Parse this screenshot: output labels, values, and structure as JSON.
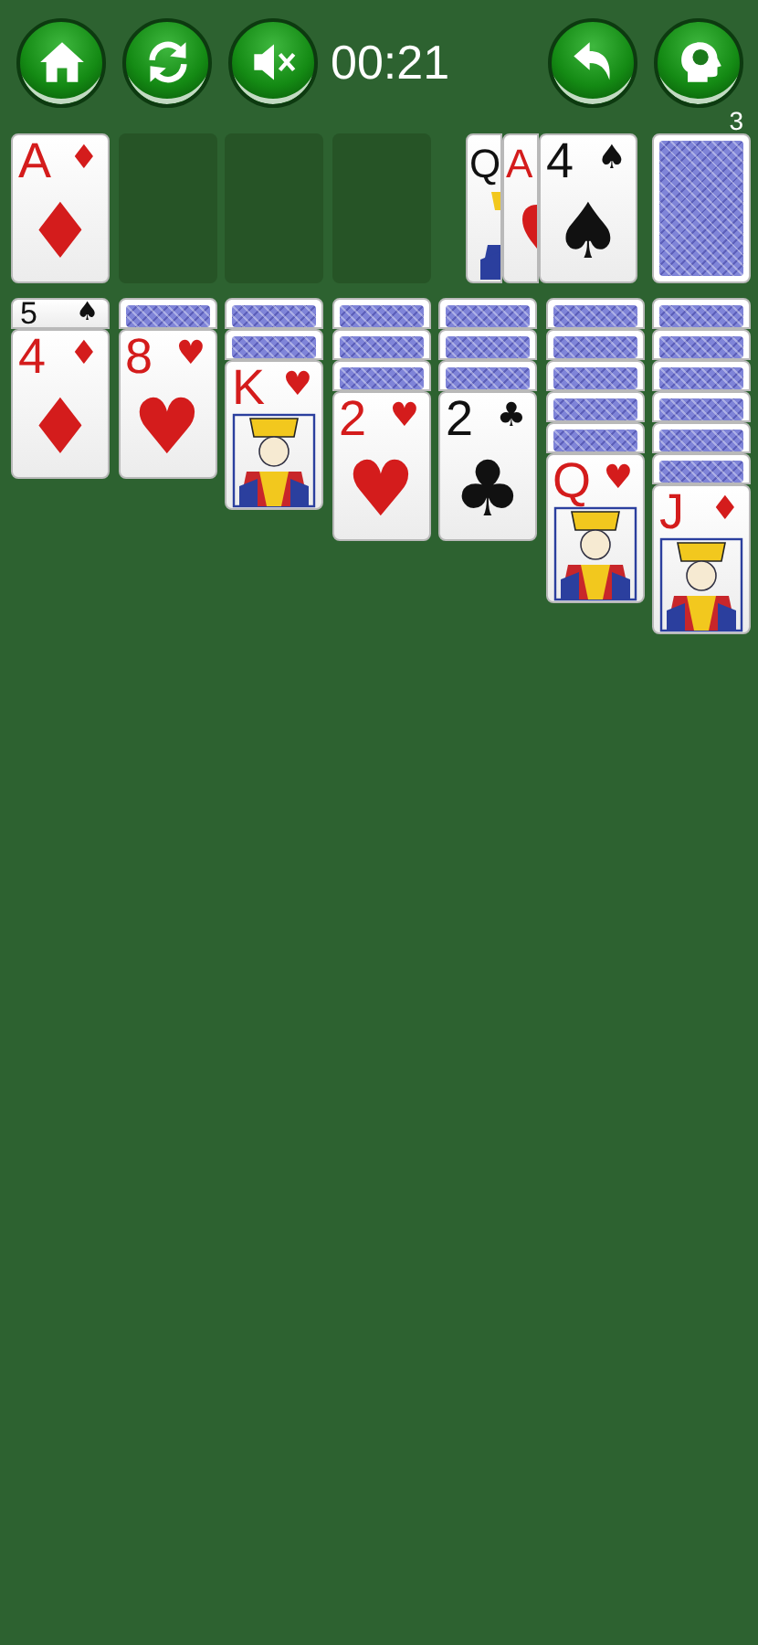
{
  "toolbar": {
    "left_buttons": [
      {
        "kind": "home"
      },
      {
        "kind": "restart"
      },
      {
        "kind": "sound",
        "muted": true
      }
    ],
    "timer": "00:21",
    "right_buttons": [
      {
        "kind": "undo"
      },
      {
        "kind": "hint",
        "badge": "3"
      }
    ]
  },
  "foundations": [
    {
      "kind": "pip",
      "rank": "A",
      "red": true,
      "corner_suit": "♦",
      "center_suit": "♦"
    },
    {
      "kind": "empty"
    },
    {
      "kind": "empty"
    },
    {
      "kind": "empty"
    }
  ],
  "waste": [
    {
      "kind": "court",
      "rank": "Q",
      "red": false
    },
    {
      "kind": "pip",
      "rank": "A",
      "red": true
    },
    {
      "kind": "pip",
      "rank": "4",
      "red": false,
      "corner_suit": "♠",
      "center_suit": "♠"
    }
  ],
  "stock": {
    "kind": "back"
  },
  "tableau": [
    {
      "cards": [
        {
          "kind": "pip",
          "rank": "5",
          "red": false,
          "corner_suit": "♠"
        },
        {
          "kind": "pip",
          "rank": "4",
          "red": true,
          "corner_suit": "♦",
          "center_suit": "♦"
        }
      ]
    },
    {
      "cards": [
        {
          "kind": "back"
        },
        {
          "kind": "pip",
          "rank": "8",
          "red": true,
          "corner_suit": "♥",
          "center_suit": "♥"
        }
      ]
    },
    {
      "cards": [
        {
          "kind": "back"
        },
        {
          "kind": "back"
        },
        {
          "kind": "court",
          "rank": "K",
          "red": true,
          "corner_suit": "♥"
        }
      ]
    },
    {
      "cards": [
        {
          "kind": "back"
        },
        {
          "kind": "back"
        },
        {
          "kind": "back"
        },
        {
          "kind": "pip",
          "rank": "2",
          "red": true,
          "corner_suit": "♥",
          "center_suit": "♥"
        }
      ]
    },
    {
      "cards": [
        {
          "kind": "back"
        },
        {
          "kind": "back"
        },
        {
          "kind": "back"
        },
        {
          "kind": "pip",
          "rank": "2",
          "red": false,
          "corner_suit": "♣",
          "center_suit": "♣"
        }
      ]
    },
    {
      "cards": [
        {
          "kind": "back"
        },
        {
          "kind": "back"
        },
        {
          "kind": "back"
        },
        {
          "kind": "back"
        },
        {
          "kind": "back"
        },
        {
          "kind": "court",
          "rank": "Q",
          "red": true,
          "corner_suit": "♥"
        }
      ]
    },
    {
      "cards": [
        {
          "kind": "back"
        },
        {
          "kind": "back"
        },
        {
          "kind": "back"
        },
        {
          "kind": "back"
        },
        {
          "kind": "back"
        },
        {
          "kind": "back"
        },
        {
          "kind": "court",
          "rank": "J",
          "red": true,
          "corner_suit": "♦"
        }
      ]
    }
  ]
}
